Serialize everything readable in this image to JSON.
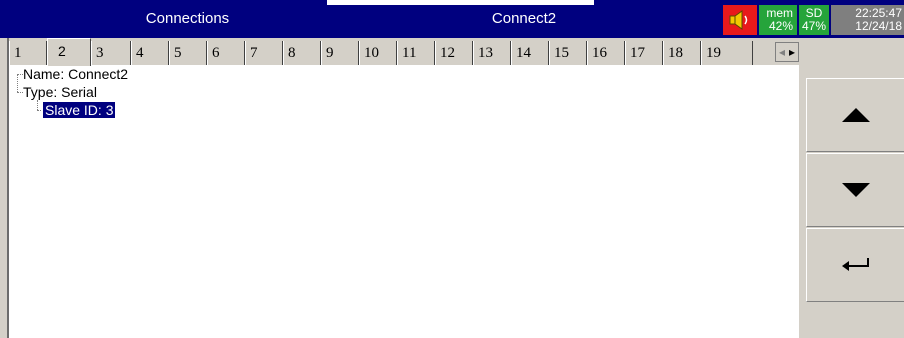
{
  "header": {
    "left_title": "Connections",
    "center_title": "Connect2",
    "mem_label": "mem",
    "mem_value": "42%",
    "sd_label": "SD",
    "sd_value": "47%",
    "time": "22:25:47",
    "date": "12/24/18"
  },
  "tabs": [
    "1",
    "2",
    "3",
    "4",
    "5",
    "6",
    "7",
    "8",
    "9",
    "10",
    "11",
    "12",
    "13",
    "14",
    "15",
    "16",
    "17",
    "18",
    "19"
  ],
  "active_tab": "2",
  "tab_scroll": {
    "left": "◂",
    "right": "▸"
  },
  "tree": {
    "name": "Name: Connect2",
    "type": "Type: Serial",
    "slave_id": "Slave ID: 3"
  },
  "colors": {
    "titlebar": "#00007f",
    "alarm": "#e8191b",
    "status_ok": "#26a43b",
    "clock_bg": "#7f7f7f",
    "panel": "#d4d0c8"
  },
  "icons": {
    "speaker": "speaker-icon",
    "up": "arrow-up-icon",
    "down": "arrow-down-icon",
    "enter": "enter-icon"
  }
}
